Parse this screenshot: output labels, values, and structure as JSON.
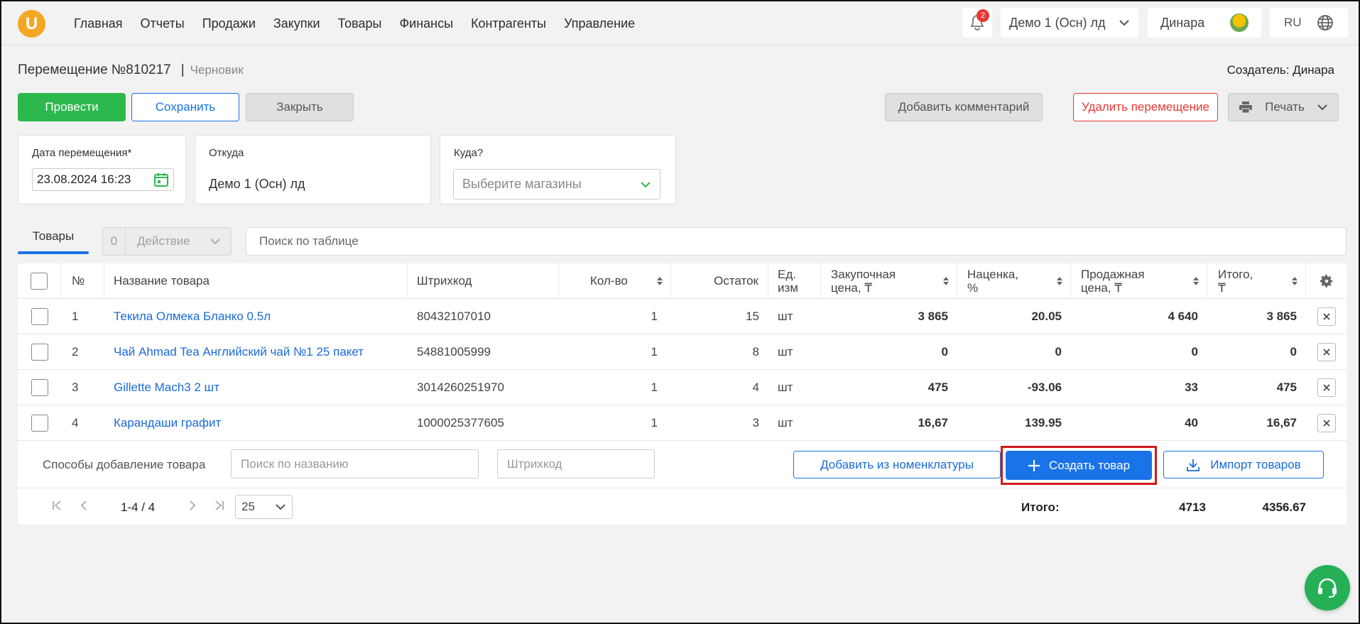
{
  "nav": {
    "logo_letter": "U",
    "items": [
      "Главная",
      "Отчеты",
      "Продажи",
      "Закупки",
      "Товары",
      "Финансы",
      "Контрагенты",
      "Управление"
    ],
    "notifications_count": "2",
    "store": "Демо 1 (Осн) лд",
    "user": "Динара",
    "lang": "RU"
  },
  "doc": {
    "title": "Перемещение №810217",
    "separator": "|",
    "status": "Черновик",
    "creator": "Создатель: Динара"
  },
  "buttons": {
    "conduct": "Провести",
    "save": "Сохранить",
    "close": "Закрыть",
    "comment": "Добавить комментарий",
    "delete": "Удалить перемещение",
    "print": "Печать"
  },
  "fields": {
    "date_label": "Дата перемещения*",
    "date_value": "23.08.2024 16:23",
    "from_label": "Откуда",
    "from_value": "Демо 1 (Осн) лд",
    "to_label": "Куда?",
    "to_placeholder": "Выберите магазины"
  },
  "toolbar": {
    "tab": "Товары",
    "selected_count": "0",
    "action": "Действие",
    "search_placeholder": "Поиск по таблице"
  },
  "table": {
    "headers": {
      "num": "№",
      "name": "Название товара",
      "barcode": "Штрихкод",
      "qty": "Кол-во",
      "stock": "Остаток",
      "unit_1": "Ед.",
      "unit_2": "изм",
      "cost_1": "Закупочная",
      "cost_2": "цена, ₸",
      "markup_1": "Наценка,",
      "markup_2": "%",
      "price_1": "Продажная",
      "price_2": "цена, ₸",
      "total_1": "Итого,",
      "total_2": "₸"
    },
    "rows": [
      {
        "num": "1",
        "name": "Текила Олмека Бланко 0.5л",
        "barcode": "80432107010",
        "qty": "1",
        "stock": "15",
        "unit": "шт",
        "cost": "3 865",
        "markup": "20.05",
        "price": "4 640",
        "total": "3 865"
      },
      {
        "num": "2",
        "name": "Чай Ahmad Tea Английский чай №1 25 пакет",
        "barcode": "54881005999",
        "qty": "1",
        "stock": "8",
        "unit": "шт",
        "cost": "0",
        "markup": "0",
        "price": "0",
        "total": "0"
      },
      {
        "num": "3",
        "name": "Gillette Mach3 2 шт",
        "barcode": "3014260251970",
        "qty": "1",
        "stock": "4",
        "unit": "шт",
        "cost": "475",
        "markup": "-93.06",
        "price": "33",
        "total": "475"
      },
      {
        "num": "4",
        "name": "Карандаши графит",
        "barcode": "1000025377605",
        "qty": "1",
        "stock": "3",
        "unit": "шт",
        "cost": "16,67",
        "markup": "139.95",
        "price": "40",
        "total": "16,67"
      }
    ]
  },
  "add_items": {
    "label": "Способы добавление товара",
    "name_placeholder": "Поиск по названию",
    "barcode_placeholder": "Штрихкод",
    "from_nomenclature": "Добавить из номенклатуры",
    "create": "Создать товар",
    "import": "Импорт товаров"
  },
  "pager": {
    "range": "1-4 / 4",
    "page_size": "25",
    "total_label": "Итого:",
    "total_qty": "4713",
    "total_sum": "4356.67"
  },
  "colors": {
    "primary": "#1a73e8",
    "success": "#2db84d",
    "danger": "#e53935",
    "highlight": "#d01b1b"
  }
}
